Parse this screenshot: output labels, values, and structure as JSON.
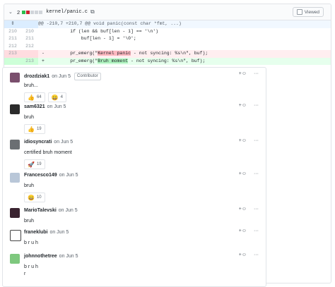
{
  "file": {
    "count": "2",
    "name": "kernel/panic.c",
    "viewed_label": "Viewed",
    "add_color": "#2cbe4e",
    "del_color": "#cb2431",
    "neutral_color": "#d1d5da"
  },
  "diff": [
    {
      "type": "hunk",
      "old": "",
      "new": "",
      "marker": "",
      "text": "@@ -210,7 +210,7 @@ void panic(const char *fmt, ...)"
    },
    {
      "type": "ctx",
      "old": "210",
      "new": "210",
      "marker": "",
      "text": "        if (len && buf[len - 1] == '\\n')"
    },
    {
      "type": "ctx",
      "old": "211",
      "new": "211",
      "marker": "",
      "text": "            buf[len - 1] = '\\0';"
    },
    {
      "type": "ctx",
      "old": "212",
      "new": "212",
      "marker": "",
      "text": ""
    },
    {
      "type": "del",
      "old": "213",
      "new": "",
      "marker": "-",
      "pre": "        pr_emerg(\"",
      "hl": "Kernel panic",
      "post": " - not syncing: %s\\n\", buf);"
    },
    {
      "type": "add",
      "old": "",
      "new": "213",
      "marker": "+",
      "pre": "        pr_emerg(\"",
      "hl": "Bruh moment",
      "post": " - not syncing: %s\\n\", buf);"
    }
  ],
  "comments": [
    {
      "author": "drozdziak1",
      "date": "on Jun 5",
      "badge": "Contributor",
      "body": "bruh...",
      "reactions": [
        {
          "emoji": "👍",
          "count": "64"
        },
        {
          "emoji": "😄",
          "count": "4"
        }
      ],
      "avatar_color": "#7a4f6d"
    },
    {
      "author": "sam6321",
      "date": "on Jun 5",
      "badge": "",
      "body": "bruh",
      "reactions": [
        {
          "emoji": "👍",
          "count": "19"
        }
      ],
      "avatar_color": "#2b2b2b"
    },
    {
      "author": "idiosyncrati",
      "date": "on Jun 5",
      "badge": "",
      "body": "certified bruh moment",
      "reactions": [
        {
          "emoji": "🚀",
          "count": "19"
        }
      ],
      "avatar_color": "#6b6f73"
    },
    {
      "author": "Francesco149",
      "date": "on Jun 5",
      "badge": "",
      "body": "bruh",
      "reactions": [
        {
          "emoji": "😄",
          "count": "10"
        }
      ],
      "avatar_color": "#b9c7d8"
    },
    {
      "author": "MarioTalevski",
      "date": "on Jun 5",
      "badge": "",
      "body": "bruh",
      "reactions": [],
      "avatar_color": "#3a2330"
    },
    {
      "author": "franeklubi",
      "date": "on Jun 5",
      "badge": "",
      "body": "b r u h",
      "reactions": [],
      "avatar_color": "#ffffff"
    },
    {
      "author": "johnnothetree",
      "date": "on Jun 5",
      "badge": "",
      "body": "b r u h",
      "body2": "r",
      "reactions": [],
      "avatar_color": "#7ec87e"
    }
  ],
  "icons": {
    "smile": "smiley-icon",
    "more": "kebab-icon"
  }
}
